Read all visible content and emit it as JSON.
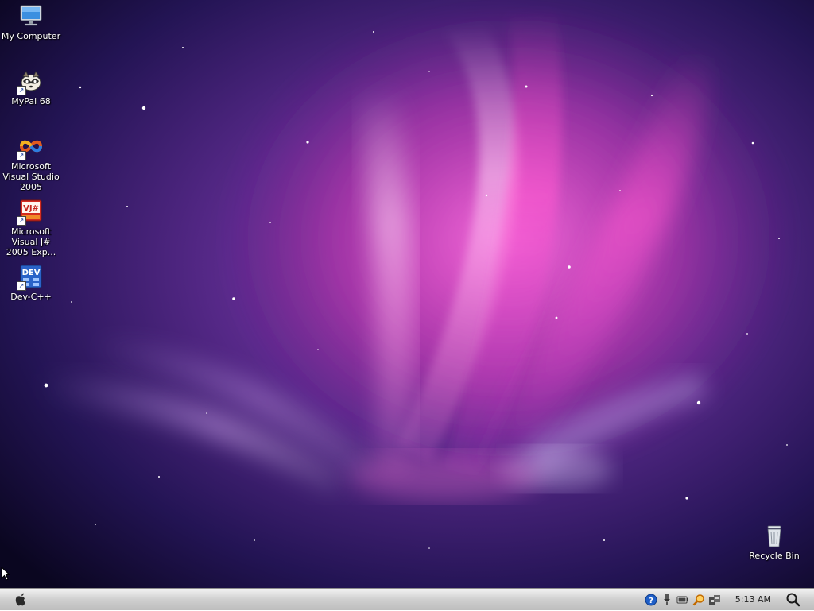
{
  "desktop": {
    "icons": [
      {
        "label": "My Computer",
        "icon": "my-computer-icon"
      },
      {
        "label": "MyPal 68",
        "icon": "mypal-icon"
      },
      {
        "label": "Microsoft Visual Studio 2005",
        "icon": "visual-studio-icon"
      },
      {
        "label": "Microsoft Visual J# 2005 Exp...",
        "icon": "visual-jsharp-icon",
        "badge": "VJ#"
      },
      {
        "label": "Dev-C++",
        "icon": "dev-cpp-icon",
        "badge": "DEV"
      }
    ],
    "recycle_bin": {
      "label": "Recycle Bin",
      "icon": "recycle-bin-icon"
    }
  },
  "taskbar": {
    "start_icon": "apple-logo-icon",
    "tray_icons": [
      "help-icon",
      "safely-remove-icon",
      "battery-icon",
      "search-tray-icon",
      "network-icon"
    ],
    "clock": "5:13 AM",
    "spotlight_icon": "spotlight-search-icon"
  },
  "colors": {
    "wallpaper_base": "#120a2e",
    "wallpaper_glow": "#c640c0",
    "taskbar": "#d0d0d0"
  }
}
